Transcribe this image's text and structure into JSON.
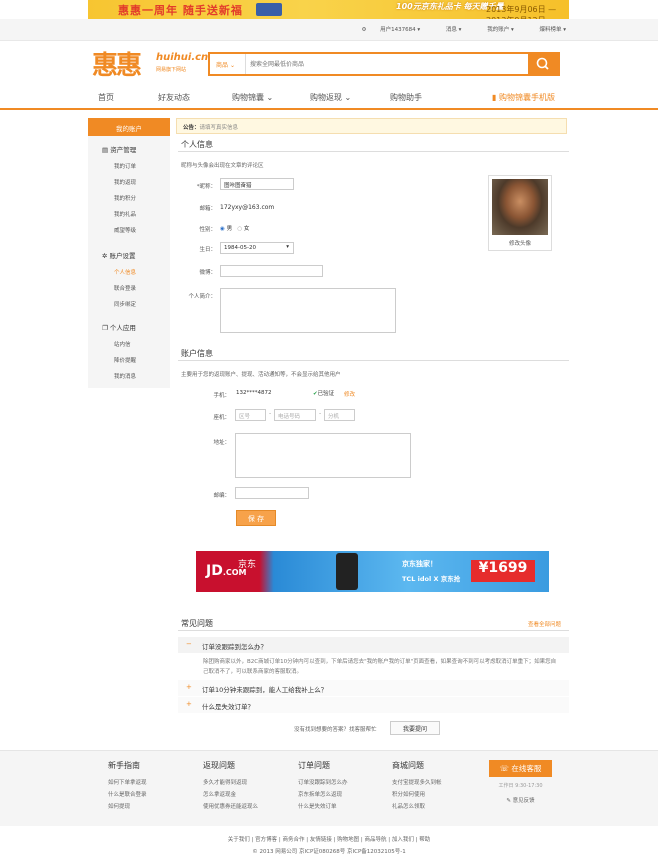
{
  "banner": {
    "left_text": "惠惠一周年 随手送新福",
    "right_slogan": "100元京东礼品卡 每天赠千量",
    "date_range": "2013年9月06日 — 2013年9月12日"
  },
  "topbar": {
    "user": "用户1437684",
    "messages": "消息",
    "my_account": "我的账户",
    "hot_list": "爆料榜单"
  },
  "logo": {
    "cn": "惠惠",
    "en": "huihui.cn",
    "tagline": "网易旗下网站"
  },
  "search": {
    "category": "商品",
    "placeholder": "搜索全网最低价商品"
  },
  "nav": {
    "home": "首页",
    "friends": "好友动态",
    "shopping_bag": "购物锦囊",
    "cashback": "购物返现",
    "assistant": "购物助手",
    "mobile": "购物锦囊手机版"
  },
  "sidebar": {
    "my_account": "我的账户",
    "asset_mgmt": "资产管理",
    "asset_items": [
      "我的订单",
      "我的返现",
      "我的积分",
      "我的礼品",
      "威望等级"
    ],
    "account_settings": "账户设置",
    "account_items": [
      "个人信息",
      "联合登录",
      "同步绑定"
    ],
    "personal_apps": "个人应用",
    "app_items": [
      "站内信",
      "降价提醒",
      "我的消息"
    ]
  },
  "notice": {
    "label": "公告：",
    "text": "请填写真实信息"
  },
  "personal": {
    "title": "个人信息",
    "desc": "昵称与头像会出现在文章的评论区",
    "nick_label": "*昵称：",
    "nick_value": "图咔图奋猎",
    "email_label": "邮箱：",
    "email_value": "172yxy@163.com",
    "gender_label": "性别：",
    "male": "男",
    "female": "女",
    "birthday_label": "生日：",
    "birthday_value": "1984-05-20",
    "weibo_label": "微博：",
    "bio_label": "个人简介：",
    "change_avatar": "修改头像"
  },
  "account": {
    "title": "账户信息",
    "desc": "主要用于您的返现账户、提现、活动通知等，不会显示给其他用户",
    "phone_label": "手机：",
    "phone_value": "132****4872",
    "verified": "已验证",
    "modify": "修改",
    "tel_label": "座机：",
    "area_code": "区号",
    "tel_number": "电话号码",
    "ext": "分机",
    "address_label": "地址：",
    "zip_label": "邮编：",
    "save": "保 存"
  },
  "ad": {
    "brand": "JD",
    "brand_com": ".COM",
    "brand_cn": "京东",
    "promo1": "京东独家！",
    "promo2": "TCL idol X 京东抢",
    "price": "¥1699"
  },
  "faq": {
    "title": "常见问题",
    "view_all": "查看全部问题",
    "q1": "订单没跟踪到怎么办？",
    "a1": "除团购商家以外，B2C商城订单10分钟内可以查到，下单后请您去\"我的账户我的订单\"页面查看，如果查询不到可以考虑取消订单重下；如果您自己取消不了，可以联系商家的客服取消。",
    "q2": "订单10分钟未跟踪到，能人工给我补上么？",
    "q3": "什么是失效订单？",
    "ask_prompt": "没有找到想要的答案？找客服帮忙",
    "ask_button": "我要提问"
  },
  "footer": {
    "cols": [
      {
        "title": "新手指南",
        "links": [
          "如何下单拿返现",
          "什么是联合登录",
          "如何提现"
        ]
      },
      {
        "title": "返现问题",
        "links": [
          "多久才能得到返现",
          "怎么拿返现金",
          "使用优惠券还能返现么"
        ]
      },
      {
        "title": "订单问题",
        "links": [
          "订单没跟踪到怎么办",
          "京东拆单怎么返现",
          "什么是失效订单"
        ]
      },
      {
        "title": "商城问题",
        "links": [
          "支付宝提现多久到帐",
          "积分如何使用",
          "礼品怎么领取"
        ]
      }
    ],
    "customer_service": "在线客服",
    "hours": "工作日 9:30-17:30",
    "feedback": "意见反馈",
    "bottom_links": "关于我们 | 官方博客 | 商务合作 | 友情链接 | 购物地图 | 商品导航 | 加入我们 | 帮助",
    "copyright": "© 2013 网易公司 京ICP证080268号 京ICP备12032105号-1"
  }
}
